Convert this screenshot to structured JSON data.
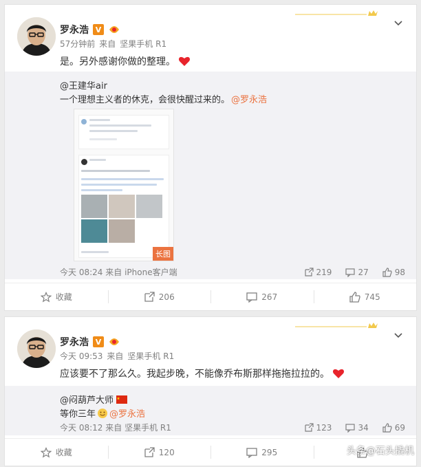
{
  "colors": {
    "accent": "#eb7340",
    "vip_badge": "#f08c18",
    "heart": "#e8242c",
    "muted": "#808080"
  },
  "posts": [
    {
      "author": "罗永浩",
      "time": "57分钟前",
      "source_prefix": "来自",
      "source": "坚果手机 R1",
      "text": "是。另外感谢你做的整理。",
      "text_emoji": "heart-icon",
      "repost": {
        "author": "@王建华air",
        "text": "一个理想主义者的休克，会很快醒过来的。",
        "mention": "@罗永浩",
        "image_tag": "长图",
        "time": "今天 08:24",
        "source_prefix": "来自",
        "source": "iPhone客户端",
        "reposts": "219",
        "comments": "27",
        "likes": "98"
      },
      "actions": {
        "favorite": "收藏",
        "repost": "206",
        "comment": "267",
        "like": "745"
      }
    },
    {
      "author": "罗永浩",
      "time": "今天 09:53",
      "source_prefix": "来自",
      "source": "坚果手机 R1",
      "text": "应该要不了那么久。我起步晚，不能像乔布斯那样拖拖拉拉的。",
      "text_emoji": "heart-icon",
      "repost": {
        "author": "@闷葫芦大师",
        "text": "等你三年",
        "mention": "@罗永浩",
        "time": "今天 08:12",
        "source_prefix": "来自",
        "source": "坚果手机 R1",
        "reposts": "123",
        "comments": "34",
        "likes": "69"
      },
      "actions": {
        "favorite": "收藏",
        "repost": "120",
        "comment": "295",
        "like": ""
      }
    }
  ],
  "watermark": "头条@石头撬机"
}
